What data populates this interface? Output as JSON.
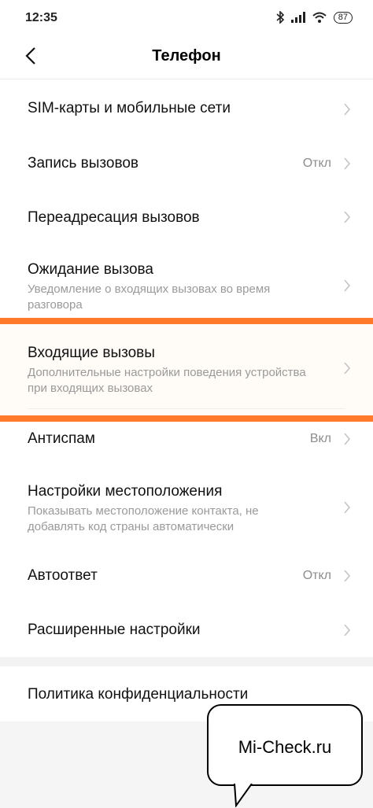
{
  "status_bar": {
    "time": "12:35",
    "battery": "87",
    "icons": [
      "bluetooth-icon",
      "signal-icon",
      "wifi-icon",
      "battery-icon"
    ]
  },
  "header": {
    "title": "Телефон",
    "back_icon": "back-arrow-icon"
  },
  "rows": [
    {
      "label": "SIM-карты и мобильные сети"
    },
    {
      "label": "Запись вызовов",
      "value": "Откл"
    },
    {
      "label": "Переадресация вызовов"
    },
    {
      "label": "Ожидание вызова",
      "sub": "Уведомление о входящих вызовах во время разговора"
    },
    {
      "label": "Входящие вызовы",
      "sub": "Дополнительные настройки поведения устройства при входящих вызовах"
    },
    {
      "label": "Антиспам",
      "value": "Вкл"
    },
    {
      "label": "Настройки местоположения",
      "sub": "Показывать местоположение контакта, не добавлять код страны автоматически"
    },
    {
      "label": "Автоответ",
      "value": "Откл"
    },
    {
      "label": "Расширенные настройки"
    }
  ],
  "privacy": {
    "label": "Политика конфиденциальности"
  },
  "watermark": {
    "text": "Mi-Check.ru"
  },
  "colors": {
    "highlight": "#ff7a2a",
    "chevron": "#c4c4c4",
    "secondary_text": "#9a9a9a"
  }
}
